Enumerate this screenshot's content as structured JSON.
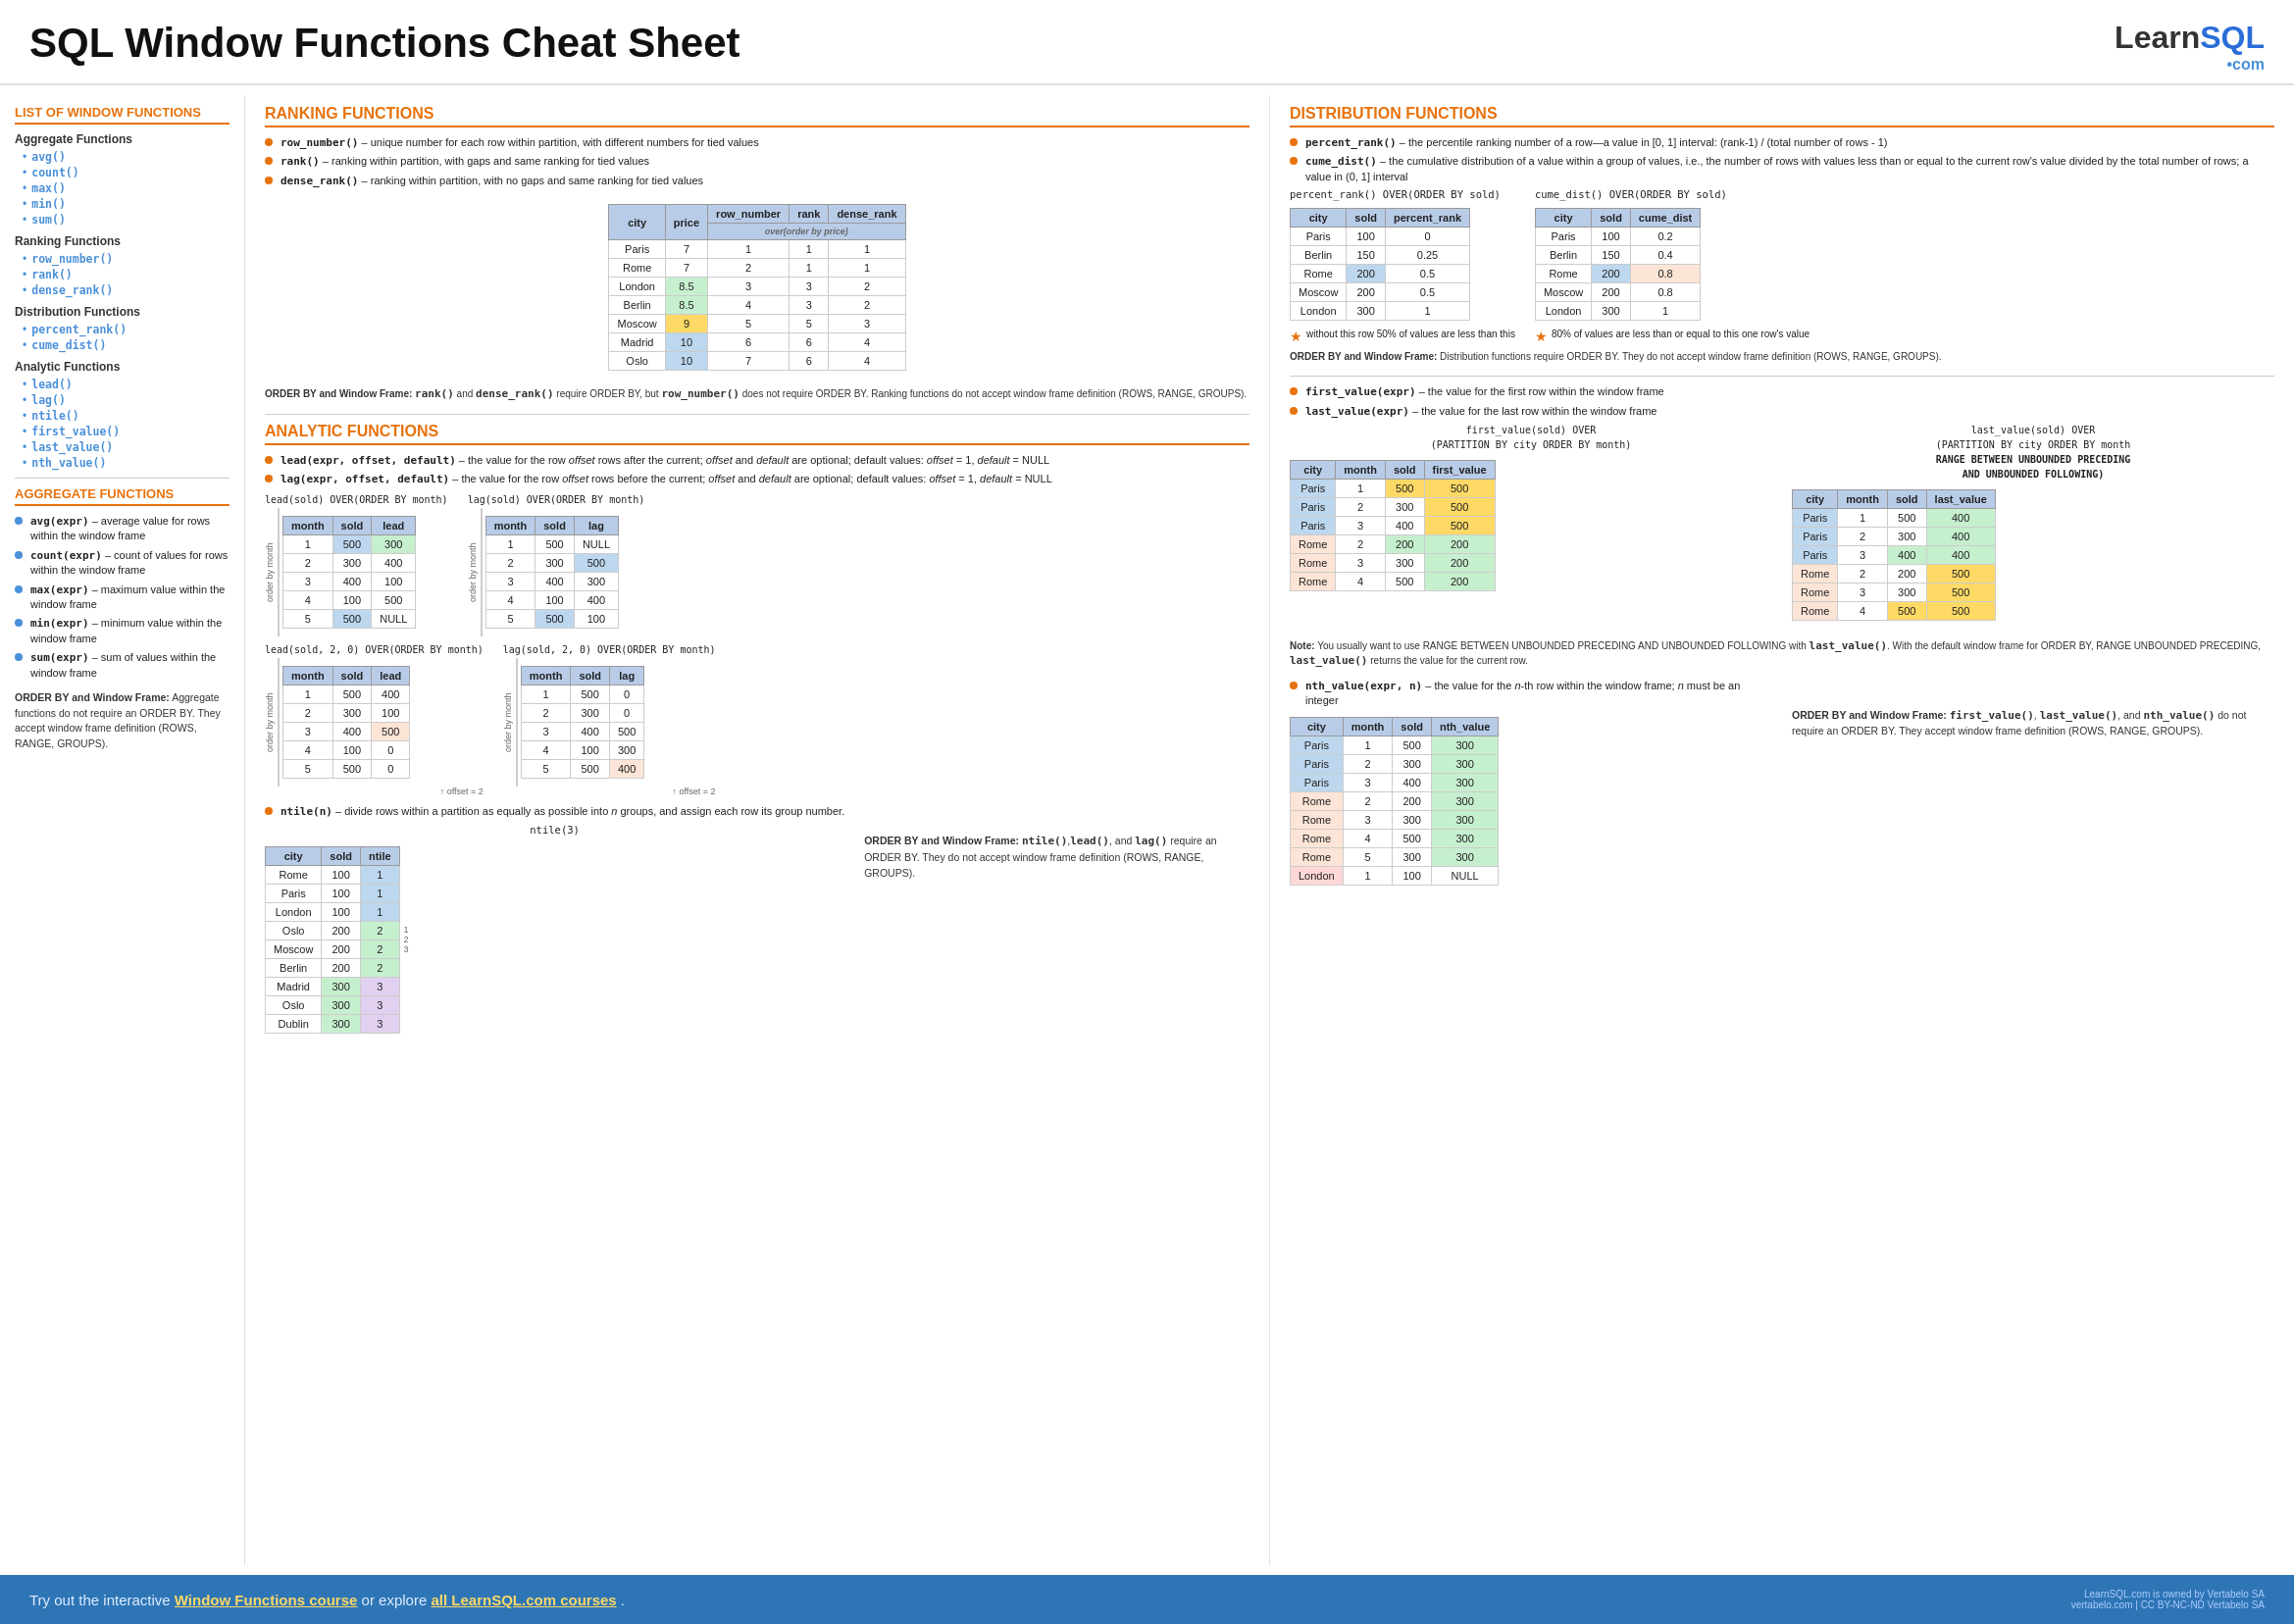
{
  "header": {
    "title": "SQL Window Functions Cheat Sheet",
    "logo_learn": "Learn",
    "logo_sql": "SQL",
    "logo_dot": "•",
    "logo_com": "com"
  },
  "sidebar": {
    "main_title": "LIST OF WINDOW FUNCTIONS",
    "aggregate_title": "Aggregate Functions",
    "aggregate_items": [
      "avg()",
      "count()",
      "max()",
      "min()",
      "sum()"
    ],
    "ranking_title": "Ranking Functions",
    "ranking_items": [
      "row_number()",
      "rank()",
      "dense_rank()"
    ],
    "distribution_title": "Distribution Functions",
    "distribution_items": [
      "percent_rank()",
      "cume_dist()"
    ],
    "analytic_title": "Analytic Functions",
    "analytic_items": [
      "lead()",
      "lag()",
      "ntile()",
      "first_value()",
      "last_value()",
      "nth_value()"
    ],
    "agg_section_title": "AGGREGATE FUNCTIONS",
    "agg_bullets": [
      {
        "code": "avg(expr)",
        "desc": " – average value for rows within the window frame"
      },
      {
        "code": "count(expr)",
        "desc": " – count of values for rows within the window frame"
      },
      {
        "code": "max(expr)",
        "desc": " – maximum value within the window frame"
      },
      {
        "code": "min(expr)",
        "desc": " – minimum value within the window frame"
      },
      {
        "code": "sum(expr)",
        "desc": " – sum of values within the window frame"
      }
    ],
    "order_note_title": "ORDER BY and Window Frame:",
    "order_note": " Aggregate functions do not require an ORDER BY. They accept window frame definition (ROWS, RANGE, GROUPS)."
  },
  "ranking": {
    "section_title": "RANKING FUNCTIONS",
    "bullets": [
      {
        "code": "row_number()",
        "desc": " – unique number for each row within partition, with different numbers for tied values"
      },
      {
        "code": "rank()",
        "desc": " – ranking within partition, with gaps and same ranking for tied values"
      },
      {
        "code": "dense_rank()",
        "desc": " – ranking within partition, with no gaps and same ranking for tied values"
      }
    ],
    "table": {
      "headers": [
        "city",
        "price",
        "row_number",
        "rank",
        "dense_rank"
      ],
      "over_label": "over(order by price)",
      "rows": [
        {
          "city": "Paris",
          "price": "7",
          "row_number": "1",
          "rank": "1",
          "dense_rank": "1"
        },
        {
          "city": "Rome",
          "price": "7",
          "row_number": "2",
          "rank": "1",
          "dense_rank": "1"
        },
        {
          "city": "London",
          "price": "8.5",
          "row_number": "3",
          "rank": "3",
          "dense_rank": "2",
          "highlight_price": true
        },
        {
          "city": "Berlin",
          "price": "8.5",
          "row_number": "4",
          "rank": "3",
          "dense_rank": "2",
          "highlight_price": true
        },
        {
          "city": "Moscow",
          "price": "9",
          "row_number": "5",
          "rank": "5",
          "dense_rank": "3",
          "highlight_price2": true
        },
        {
          "city": "Madrid",
          "price": "10",
          "row_number": "6",
          "rank": "6",
          "dense_rank": "4",
          "highlight_price3": true
        },
        {
          "city": "Oslo",
          "price": "10",
          "row_number": "7",
          "rank": "6",
          "dense_rank": "4",
          "highlight_price3": true
        }
      ]
    },
    "note": "ORDER BY and Window Frame: rank() and dense_rank() require ORDER BY, but row_number() does not require ORDER BY. Ranking functions do not accept window frame definition (ROWS, RANGE, GROUPS)."
  },
  "distribution": {
    "section_title": "DISTRIBUTION FUNCTIONS",
    "bullets": [
      {
        "code": "percent_rank()",
        "desc": " – the percentile ranking number of a row—a value in [0, 1] interval: (rank-1) / (total number of rows - 1)"
      },
      {
        "code": "cume_dist()",
        "desc": " – the cumulative distribution of a value within a group of values, i.e., the number of rows with values less than or equal to the current row's value divided by the total number of rows; a value in (0, 1] interval"
      }
    ],
    "percent_table": {
      "title": "percent_rank() OVER(ORDER BY sold)",
      "headers": [
        "city",
        "sold",
        "percent_rank"
      ],
      "rows": [
        {
          "city": "Paris",
          "sold": "100",
          "percent_rank": "0"
        },
        {
          "city": "Berlin",
          "sold": "150",
          "percent_rank": "0.25"
        },
        {
          "city": "Rome",
          "sold": "200",
          "percent_rank": "0.5",
          "highlight": true
        },
        {
          "city": "Moscow",
          "sold": "200",
          "percent_rank": "0.5"
        },
        {
          "city": "London",
          "sold": "300",
          "percent_rank": "1"
        }
      ]
    },
    "cume_table": {
      "title": "cume_dist() OVER(ORDER BY sold)",
      "headers": [
        "city",
        "sold",
        "cume_dist"
      ],
      "rows": [
        {
          "city": "Paris",
          "sold": "100",
          "cume_dist": "0.2"
        },
        {
          "city": "Berlin",
          "sold": "150",
          "cume_dist": "0.4"
        },
        {
          "city": "Rome",
          "sold": "200",
          "cume_dist": "0.8",
          "highlight": true
        },
        {
          "city": "Moscow",
          "sold": "200",
          "cume_dist": "0.8"
        },
        {
          "city": "London",
          "sold": "300",
          "cume_dist": "1"
        }
      ]
    },
    "star_note1": "without this row 50% of values are less than this",
    "star_note2": "80% of values are less than or equal to this one row's value",
    "order_note": "ORDER BY and Window Frame: Distribution functions require ORDER BY. They do not accept window frame definition (ROWS, RANGE, GROUPS)."
  },
  "analytic": {
    "section_title": "ANALYTIC FUNCTIONS",
    "lead_bullet": {
      "code": "lead",
      "sig": "(expr, offset, default)",
      "desc": " – the value for the row offset rows after the current; offset and default are optional; default values: offset = 1, default = NULL"
    },
    "lag_bullet": {
      "code": "lag",
      "sig": "(expr, offset, default)",
      "desc": " – the value for the row offset rows before the current; offset and default are optional; default values: offset = 1, default = NULL"
    },
    "lead_table1": {
      "title": "lead(sold) OVER(ORDER BY month)",
      "headers": [
        "month",
        "sold",
        "lead"
      ],
      "rows": [
        {
          "month": "1",
          "sold": "500",
          "lead": "300",
          "sold_color": "blue"
        },
        {
          "month": "2",
          "sold": "300",
          "lead": "400"
        },
        {
          "month": "3",
          "sold": "400",
          "lead": "100"
        },
        {
          "month": "4",
          "sold": "100",
          "lead": "500"
        },
        {
          "month": "5",
          "sold": "500",
          "lead": "NULL",
          "sold_color": "blue"
        }
      ]
    },
    "lag_table1": {
      "title": "lag(sold) OVER(ORDER BY month)",
      "headers": [
        "month",
        "sold",
        "lag"
      ],
      "rows": [
        {
          "month": "1",
          "sold": "500",
          "lag": "NULL"
        },
        {
          "month": "2",
          "sold": "300",
          "lag": "500",
          "lag_color": "blue"
        },
        {
          "month": "3",
          "sold": "400",
          "lag": "300"
        },
        {
          "month": "4",
          "sold": "100",
          "lag": "400"
        },
        {
          "month": "5",
          "sold": "500",
          "lag": "100",
          "sold_color": "blue"
        }
      ]
    },
    "lead_table2": {
      "title": "lead(sold, 2, 0) OVER(ORDER BY month)",
      "headers": [
        "month",
        "sold",
        "lead"
      ],
      "rows": [
        {
          "month": "1",
          "sold": "500",
          "lead": "400"
        },
        {
          "month": "2",
          "sold": "300",
          "lead": "100"
        },
        {
          "month": "3",
          "sold": "400",
          "lead": "500",
          "lead_color": "orange"
        },
        {
          "month": "4",
          "sold": "100",
          "lead": "0"
        },
        {
          "month": "5",
          "sold": "500",
          "lead": "0"
        }
      ]
    },
    "lag_table2": {
      "title": "lag(sold, 2, 0) OVER(ORDER BY month)",
      "headers": [
        "month",
        "sold",
        "lag"
      ],
      "rows": [
        {
          "month": "1",
          "sold": "500",
          "lag": "0"
        },
        {
          "month": "2",
          "sold": "300",
          "lag": "0"
        },
        {
          "month": "3",
          "sold": "400",
          "lag": "500"
        },
        {
          "month": "4",
          "sold": "100",
          "lag": "300"
        },
        {
          "month": "5",
          "sold": "500",
          "lag": "400",
          "lag_color": "orange"
        }
      ]
    },
    "ntile_bullet": {
      "code": "ntile",
      "sig": "(n)",
      "desc": " – divide rows within a partition as equally as possible into n groups, and assign each row its group number."
    },
    "ntile_table": {
      "title": "ntile(3)",
      "headers": [
        "city",
        "sold",
        "ntile"
      ],
      "rows": [
        {
          "city": "Rome",
          "sold": "100",
          "ntile": "1",
          "ntile_color": "blue"
        },
        {
          "city": "Paris",
          "sold": "100",
          "ntile": "1",
          "ntile_color": "blue"
        },
        {
          "city": "London",
          "sold": "100",
          "ntile": "1",
          "ntile_color": "blue"
        },
        {
          "city": "Oslo",
          "sold": "200",
          "ntile": "2",
          "ntile_color": "green"
        },
        {
          "city": "Moscow",
          "sold": "200",
          "ntile": "2",
          "ntile_color": "green"
        },
        {
          "city": "Berlin",
          "sold": "200",
          "ntile": "2",
          "ntile_color": "green"
        },
        {
          "city": "Madrid",
          "sold": "300",
          "ntile": "3",
          "ntile_color": "purple"
        },
        {
          "city": "Oslo",
          "sold": "300",
          "ntile": "3",
          "ntile_color": "purple"
        },
        {
          "city": "Dublin",
          "sold": "300",
          "ntile": "3",
          "ntile_color": "purple"
        }
      ]
    },
    "ntile_note": "ORDER BY and Window Frame: ntile(),lead(), and lag() require an ORDER BY. They do not accept window frame definition (ROWS, RANGE, GROUPS).",
    "first_value_bullet": {
      "code": "first_value",
      "sig": "(expr)",
      "desc": " – the value for the first row within the window frame"
    },
    "last_value_bullet": {
      "code": "last_value",
      "sig": "(expr)",
      "desc": " – the value for the last row within the window frame"
    },
    "first_value_table": {
      "title1": "first_value(sold) OVER",
      "title2": "(PARTITION BY city ORDER BY month)",
      "headers": [
        "city",
        "month",
        "sold",
        "first_value"
      ],
      "rows": [
        {
          "city": "Paris",
          "month": "1",
          "sold": "500",
          "first_value": "500",
          "city_color": "blue"
        },
        {
          "city": "Paris",
          "month": "2",
          "sold": "300",
          "first_value": "500",
          "city_color": "blue"
        },
        {
          "city": "Paris",
          "month": "3",
          "sold": "400",
          "first_value": "500",
          "city_color": "blue"
        },
        {
          "city": "Rome",
          "month": "2",
          "sold": "200",
          "first_value": "200",
          "city_color": "orange"
        },
        {
          "city": "Rome",
          "month": "3",
          "sold": "300",
          "first_value": "200",
          "city_color": "orange"
        },
        {
          "city": "Rome",
          "month": "4",
          "sold": "500",
          "first_value": "200",
          "city_color": "orange"
        }
      ]
    },
    "last_value_table": {
      "title1": "last_value(sold) OVER",
      "title2": "(PARTITION BY city ORDER BY month",
      "title3": "RANGE BETWEEN UNBOUNDED PRECEDING",
      "title4": "AND UNBOUNDED FOLLOWING)",
      "headers": [
        "city",
        "month",
        "sold",
        "last_value"
      ],
      "rows": [
        {
          "city": "Paris",
          "month": "1",
          "sold": "500",
          "last_value": "400",
          "city_color": "blue"
        },
        {
          "city": "Paris",
          "month": "2",
          "sold": "300",
          "last_value": "400",
          "city_color": "blue"
        },
        {
          "city": "Paris",
          "month": "3",
          "sold": "400",
          "last_value": "400",
          "city_color": "blue"
        },
        {
          "city": "Rome",
          "month": "2",
          "sold": "200",
          "last_value": "500",
          "city_color": "orange"
        },
        {
          "city": "Rome",
          "month": "3",
          "sold": "300",
          "last_value": "500",
          "city_color": "orange"
        },
        {
          "city": "Rome",
          "month": "4",
          "sold": "500",
          "last_value": "500",
          "city_color": "orange"
        }
      ]
    },
    "last_value_note": "Note: You usually want to use RANGE BETWEEN UNBOUNDED PRECEDING AND UNBOUNDED FOLLOWING with last_value(). With the default window frame for ORDER BY, RANGE UNBOUNDED PRECEDING, last_value() returns the value for the current row.",
    "nth_value_bullet": {
      "code": "nth_value",
      "sig": "(expr, n)",
      "desc": " – the value for the n-th row within the window frame; n must be an integer"
    },
    "nth_value_table": {
      "title": "",
      "headers": [
        "city",
        "month",
        "sold",
        "nth_value"
      ],
      "rows": [
        {
          "city": "Paris",
          "month": "1",
          "sold": "500",
          "nth_value": "300",
          "city_color": "blue"
        },
        {
          "city": "Paris",
          "month": "2",
          "sold": "300",
          "nth_value": "300",
          "city_color": "blue"
        },
        {
          "city": "Paris",
          "month": "3",
          "sold": "400",
          "nth_value": "300",
          "city_color": "blue"
        },
        {
          "city": "Rome",
          "month": "2",
          "sold": "200",
          "nth_value": "300",
          "city_color": "orange"
        },
        {
          "city": "Rome",
          "month": "3",
          "sold": "300",
          "nth_value": "300",
          "city_color": "orange"
        },
        {
          "city": "Rome",
          "month": "4",
          "sold": "500",
          "nth_value": "300",
          "city_color": "orange"
        },
        {
          "city": "Rome",
          "month": "5",
          "sold": "300",
          "nth_value": "300",
          "city_color": "orange"
        },
        {
          "city": "London",
          "month": "1",
          "sold": "100",
          "nth_value": "NULL",
          "city_color": "pink"
        }
      ]
    },
    "nth_value_order_note": "ORDER BY and Window Frame: first_value(), last_value(), and nth_value() do not require an ORDER BY. They accept window frame definition (ROWS, RANGE, GROUPS)."
  },
  "footer": {
    "text": "Try out the interactive ",
    "link1": "Window Functions course",
    "middle": " or explore ",
    "link2": "all LearnSQL.com courses",
    "end": ".",
    "right1": "LearnSQL.com is owned by Vertabelo SA",
    "right2": "vertabelo.com | CC BY-NC-ND Vertabelo SA"
  }
}
